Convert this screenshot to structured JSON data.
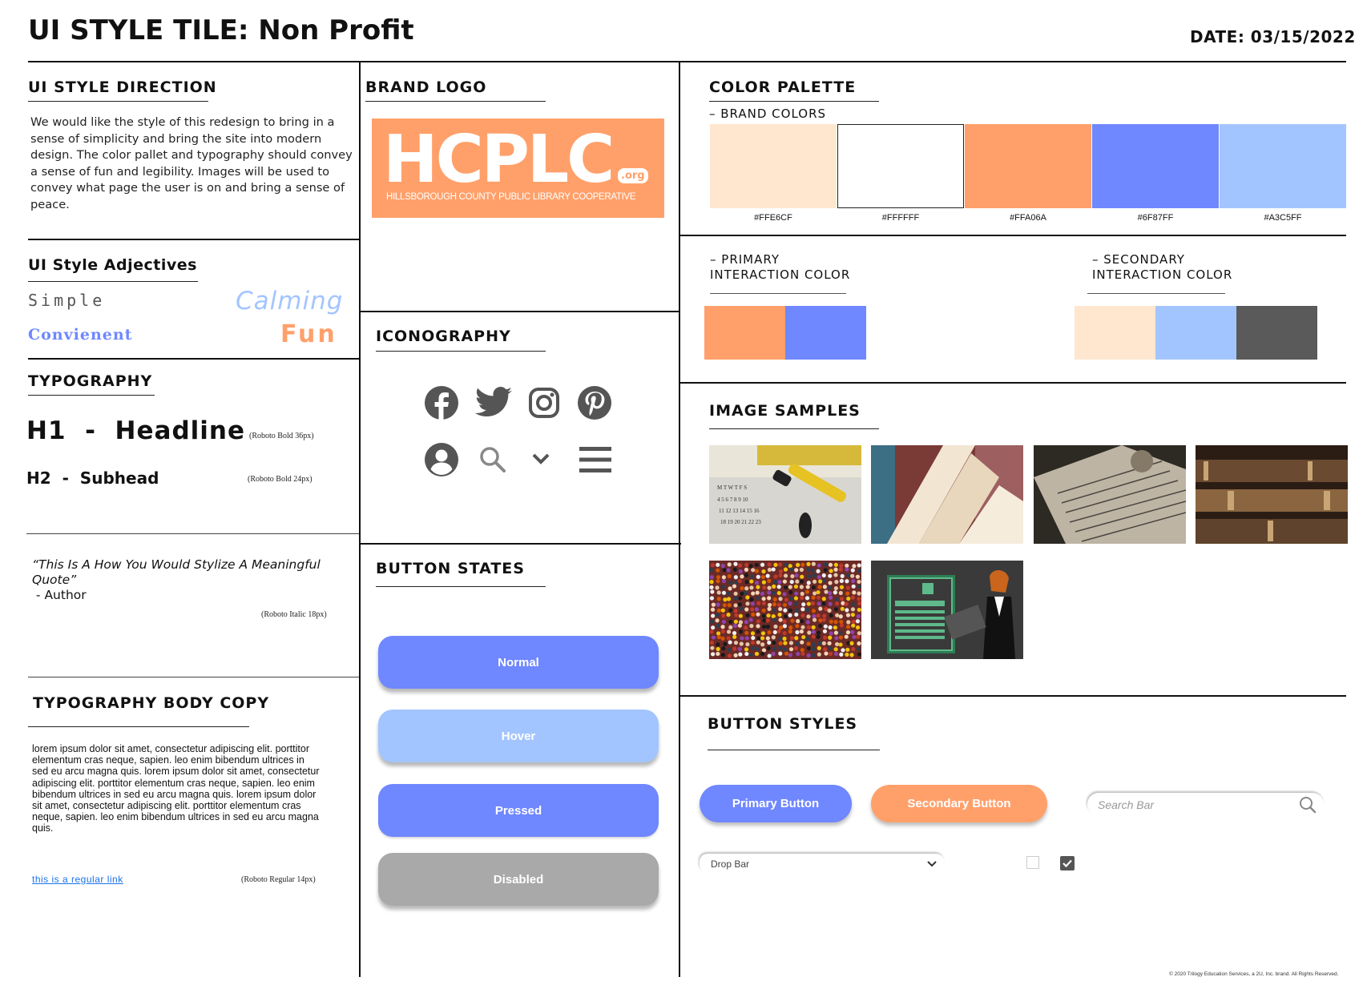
{
  "header": {
    "title": "UI STYLE TILE: Non Profit",
    "date": "DATE: 03/15/2022"
  },
  "direction": {
    "heading": "UI STYLE DIRECTION",
    "text": "We would like the style of this redesign to bring in a sense of simplicity and bring the site into modern design. The color pallet and typography should convey a sense of fun and legibility. Images will be used to convey what page the user is on and bring a sense of peace."
  },
  "adjectives": {
    "heading": "UI Style Adjectives",
    "simple": "Simple",
    "calming": "Calming",
    "convenient": "Convienent",
    "fun": "Fun"
  },
  "typography": {
    "heading": "TYPOGRAPHY",
    "h1": "H1  -  Headline",
    "h1_note": "(Roboto Bold 36px)",
    "h2": "H2  -  Subhead",
    "h2_note": "(Roboto Bold 24px)",
    "quote": "“This Is A How You Would Stylize A Meaningful Quote”",
    "author": " - Author",
    "quote_note": "(Roboto Italic 18px)"
  },
  "body_copy": {
    "heading": "TYPOGRAPHY BODY COPY",
    "text": "lorem ipsum dolor sit amet, consectetur adipiscing elit. porttitor elementum cras neque, sapien. leo enim bibendum ultrices in sed eu arcu magna quis. lorem ipsum dolor sit amet, consectetur adipiscing elit. porttitor elementum cras neque, sapien. leo enim bibendum ultrices in sed eu arcu magna quis. lorem ipsum dolor sit amet, consectetur adipiscing elit. porttitor elementum cras neque, sapien. leo enim bibendum ultrices in sed eu arcu magna quis.",
    "link": "this is a regular link",
    "note": "(Roboto Regular 14px)"
  },
  "brand_logo": {
    "heading": "BRAND LOGO",
    "logo_main": "HCPLC",
    "logo_badge": ".org",
    "logo_sub": "HILLSBOROUGH COUNTY PUBLIC LIBRARY COOPERATIVE"
  },
  "iconography": {
    "heading": "ICONOGRAPHY",
    "icons": [
      "facebook-icon",
      "twitter-icon",
      "instagram-icon",
      "pinterest-icon",
      "user-icon",
      "search-icon",
      "chevron-down-icon",
      "menu-icon"
    ]
  },
  "button_states": {
    "heading": "BUTTON STATES",
    "normal": "Normal",
    "hover": "Hover",
    "pressed": "Pressed",
    "disabled": "Disabled"
  },
  "palette": {
    "heading": "COLOR PALETTE",
    "brand_label": "– BRAND COLORS",
    "colors": [
      "#FFE6CF",
      "#FFFFFF",
      "#FFA06A",
      "#6F87FF",
      "#A3C5FF"
    ],
    "primary_label_1": "– PRIMARY",
    "primary_label_2": "INTERACTION COLOR",
    "secondary_label_1": "– SECONDARY",
    "secondary_label_2": "INTERACTION COLOR",
    "primary_colors": [
      "#FFA06A",
      "#6F87FF"
    ],
    "secondary_colors": [
      "#FFE6CF",
      "#A3C5FF",
      "#5A5A5A"
    ]
  },
  "images": {
    "heading": "IMAGE SAMPLES"
  },
  "button_styles": {
    "heading": "BUTTON STYLES",
    "primary": "Primary Button",
    "secondary": "Secondary Button",
    "search_placeholder": "Search Bar",
    "dropdown": "Drop Bar"
  },
  "footer": {
    "copyright": "© 2020 Trilogy Education Services, a 2U, Inc. brand. All Rights Reserved."
  }
}
